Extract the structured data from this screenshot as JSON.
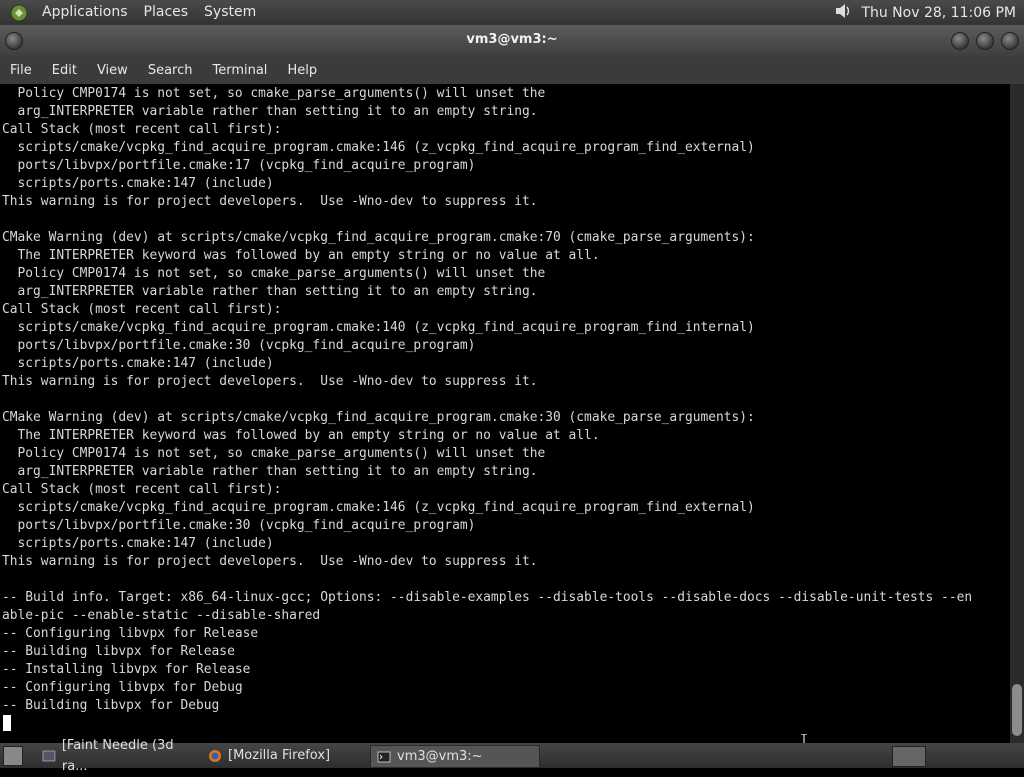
{
  "top_panel": {
    "menus": [
      "Applications",
      "Places",
      "System"
    ],
    "clock": "Thu Nov 28, 11:06 PM",
    "volume_icon": "speaker-icon"
  },
  "window": {
    "title": "vm3@vm3:~"
  },
  "menubar": [
    "File",
    "Edit",
    "View",
    "Search",
    "Terminal",
    "Help"
  ],
  "terminal": {
    "lines": [
      "  Policy CMP0174 is not set, so cmake_parse_arguments() will unset the",
      "  arg_INTERPRETER variable rather than setting it to an empty string.",
      "Call Stack (most recent call first):",
      "  scripts/cmake/vcpkg_find_acquire_program.cmake:146 (z_vcpkg_find_acquire_program_find_external)",
      "  ports/libvpx/portfile.cmake:17 (vcpkg_find_acquire_program)",
      "  scripts/ports.cmake:147 (include)",
      "This warning is for project developers.  Use -Wno-dev to suppress it.",
      "",
      "CMake Warning (dev) at scripts/cmake/vcpkg_find_acquire_program.cmake:70 (cmake_parse_arguments):",
      "  The INTERPRETER keyword was followed by an empty string or no value at all.",
      "  Policy CMP0174 is not set, so cmake_parse_arguments() will unset the",
      "  arg_INTERPRETER variable rather than setting it to an empty string.",
      "Call Stack (most recent call first):",
      "  scripts/cmake/vcpkg_find_acquire_program.cmake:140 (z_vcpkg_find_acquire_program_find_internal)",
      "  ports/libvpx/portfile.cmake:30 (vcpkg_find_acquire_program)",
      "  scripts/ports.cmake:147 (include)",
      "This warning is for project developers.  Use -Wno-dev to suppress it.",
      "",
      "CMake Warning (dev) at scripts/cmake/vcpkg_find_acquire_program.cmake:30 (cmake_parse_arguments):",
      "  The INTERPRETER keyword was followed by an empty string or no value at all.",
      "  Policy CMP0174 is not set, so cmake_parse_arguments() will unset the",
      "  arg_INTERPRETER variable rather than setting it to an empty string.",
      "Call Stack (most recent call first):",
      "  scripts/cmake/vcpkg_find_acquire_program.cmake:146 (z_vcpkg_find_acquire_program_find_external)",
      "  ports/libvpx/portfile.cmake:30 (vcpkg_find_acquire_program)",
      "  scripts/ports.cmake:147 (include)",
      "This warning is for project developers.  Use -Wno-dev to suppress it.",
      "",
      "-- Build info. Target: x86_64-linux-gcc; Options: --disable-examples --disable-tools --disable-docs --disable-unit-tests --en",
      "able-pic --enable-static --disable-shared",
      "-- Configuring libvpx for Release",
      "-- Building libvpx for Release",
      "-- Installing libvpx for Release",
      "-- Configuring libvpx for Debug",
      "-- Building libvpx for Debug"
    ]
  },
  "taskbar": {
    "tasks": [
      {
        "label": "[Faint Needle (3d ra...",
        "icon": "app-icon"
      },
      {
        "label": "[Mozilla Firefox]",
        "icon": "firefox-icon"
      },
      {
        "label": "vm3@vm3:~",
        "icon": "terminal-icon"
      }
    ]
  }
}
